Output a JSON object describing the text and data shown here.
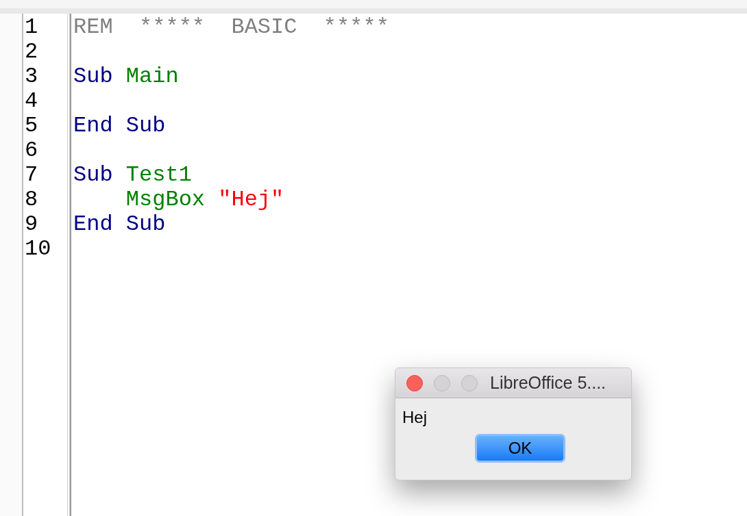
{
  "editor": {
    "lines": [
      {
        "number": "1",
        "tokens": [
          {
            "kind": "comment",
            "text": "REM  *****  BASIC  *****"
          }
        ]
      },
      {
        "number": "2"
      },
      {
        "number": "3",
        "tokens": [
          {
            "kind": "keyword",
            "text": "Sub "
          },
          {
            "kind": "name",
            "text": "Main"
          }
        ]
      },
      {
        "number": "4"
      },
      {
        "number": "5",
        "tokens": [
          {
            "kind": "keyword",
            "text": "End Sub"
          }
        ]
      },
      {
        "number": "6"
      },
      {
        "number": "7",
        "tokens": [
          {
            "kind": "keyword",
            "text": "Sub "
          },
          {
            "kind": "name",
            "text": "Test1"
          }
        ]
      },
      {
        "number": "8",
        "tokens": [
          {
            "kind": "name",
            "text": "    MsgBox "
          },
          {
            "kind": "string",
            "text": "\"Hej\""
          }
        ]
      },
      {
        "number": "9",
        "tokens": [
          {
            "kind": "keyword",
            "text": "End Sub"
          }
        ]
      },
      {
        "number": "10"
      }
    ]
  },
  "dialog": {
    "title": "LibreOffice 5....",
    "message": "Hej",
    "button": "OK"
  }
}
